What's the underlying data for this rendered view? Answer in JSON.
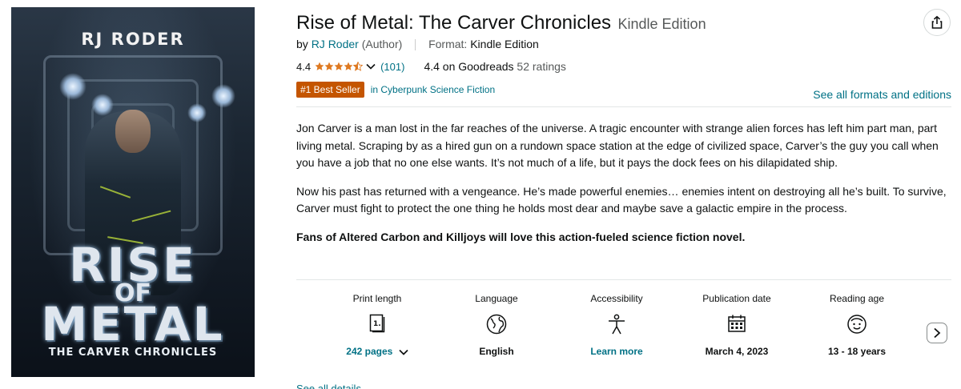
{
  "cover": {
    "author": "RJ RODER",
    "title_line1": "RISE",
    "title_line2": "OF",
    "title_line3": "METAL",
    "subtitle": "THE CARVER CHRONICLES"
  },
  "product": {
    "title": "Rise of Metal: The Carver Chronicles",
    "edition": "Kindle Edition",
    "by_prefix": "by",
    "author": "RJ Roder",
    "author_role": "(Author)",
    "format_label": "Format:",
    "format_value": "Kindle Edition",
    "rating": "4.4",
    "stars_value": 4.4,
    "rating_count": "(101)",
    "goodreads_rating": "4.4 on Goodreads",
    "goodreads_count": "52 ratings",
    "badge": "#1 Best Seller",
    "badge_category": "in Cyberpunk Science Fiction",
    "see_all_formats": "See all formats and editions"
  },
  "description": {
    "paragraph1": "Jon Carver is a man lost in the far reaches of the universe. A tragic encounter with strange alien forces has left him part man, part living metal. Scraping by as a hired gun on a rundown space station at the edge of civilized space, Carver’s the guy you call when you have a job that no one else wants. It’s not much of a life, but it pays the dock fees on his dilapidated ship.",
    "paragraph2": "Now his past has returned with a vengeance. He’s made powerful enemies… enemies intent on destroying all he’s built. To survive, Carver must fight to protect the one thing he holds most dear and maybe save a galactic empire in the process.",
    "paragraph3": "Fans of Altered Carbon and Killjoys will love this action-fueled science fiction novel."
  },
  "details": [
    {
      "label": "Print length",
      "value": "242 pages",
      "icon": "book-pages-icon"
    },
    {
      "label": "Language",
      "value": "English",
      "icon": "globe-icon"
    },
    {
      "label": "Accessibility",
      "value": "Learn more",
      "icon": "accessibility-icon"
    },
    {
      "label": "Publication date",
      "value": "March 4, 2023",
      "icon": "calendar-icon"
    },
    {
      "label": "Reading age",
      "value": "13 - 18 years",
      "icon": "child-face-icon"
    }
  ],
  "see_details": "See all details",
  "colors": {
    "link": "#007185",
    "badge": "#c45500",
    "star": "#de7921",
    "text": "#0f1111",
    "muted": "#565959"
  }
}
